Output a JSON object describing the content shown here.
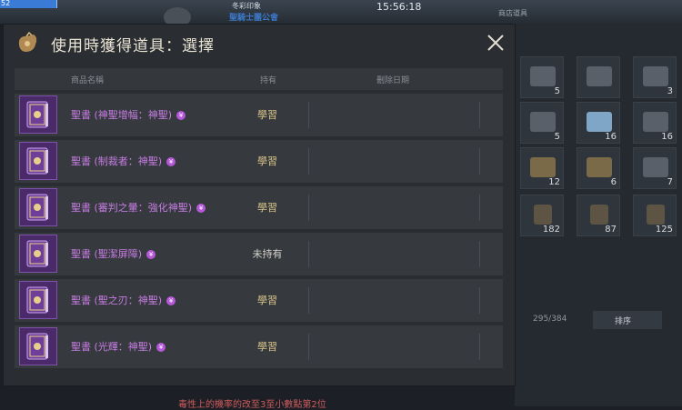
{
  "hud": {
    "hp_value": "52",
    "player_name": "冬彩印象",
    "guild_name": "聖騎士團公會",
    "clock": "15:56:18",
    "top_right": "商店道具"
  },
  "dialog": {
    "title": "使用時獲得道具：選擇",
    "columns": {
      "name": "商品名稱",
      "owned": "持有",
      "delete_date": "刪除日期"
    },
    "items": [
      {
        "name": "聖書 (神聖增幅：神聖)",
        "badge": "¥",
        "owned": "學習",
        "owned_state": "learn"
      },
      {
        "name": "聖書 (制裁者：神聖)",
        "badge": "¥",
        "owned": "學習",
        "owned_state": "learn"
      },
      {
        "name": "聖書 (審判之暈：強化神聖)",
        "badge": "¥",
        "owned": "學習",
        "owned_state": "learn"
      },
      {
        "name": "聖書 (聖潔屏障)",
        "badge": "¥",
        "owned": "未持有",
        "owned_state": "none"
      },
      {
        "name": "聖書 (聖之刃：神聖)",
        "badge": "¥",
        "owned": "學習",
        "owned_state": "learn"
      },
      {
        "name": "聖書 (光輝：神聖)",
        "badge": "¥",
        "owned": "學習",
        "owned_state": "learn"
      }
    ]
  },
  "inventory": {
    "slots": [
      {
        "count": "5",
        "kind": "box"
      },
      {
        "count": "",
        "kind": "box"
      },
      {
        "count": "3",
        "kind": "box"
      },
      {
        "count": "5",
        "kind": "box"
      },
      {
        "count": "16",
        "kind": "cube"
      },
      {
        "count": "16",
        "kind": "box"
      },
      {
        "count": "12",
        "kind": "gold"
      },
      {
        "count": "6",
        "kind": "gold"
      },
      {
        "count": "7",
        "kind": "box"
      },
      {
        "count": "182",
        "kind": "card"
      },
      {
        "count": "87",
        "kind": "card"
      },
      {
        "count": "125",
        "kind": "card"
      }
    ],
    "capacity": "295/384",
    "sort_label": "排序"
  },
  "footer_hint": "毒性上的機率的改至3至小數點第2位",
  "colors": {
    "item_name": "#c57be0",
    "owned_learn": "#d9c48a",
    "panel_bg": "#2a2d31"
  }
}
